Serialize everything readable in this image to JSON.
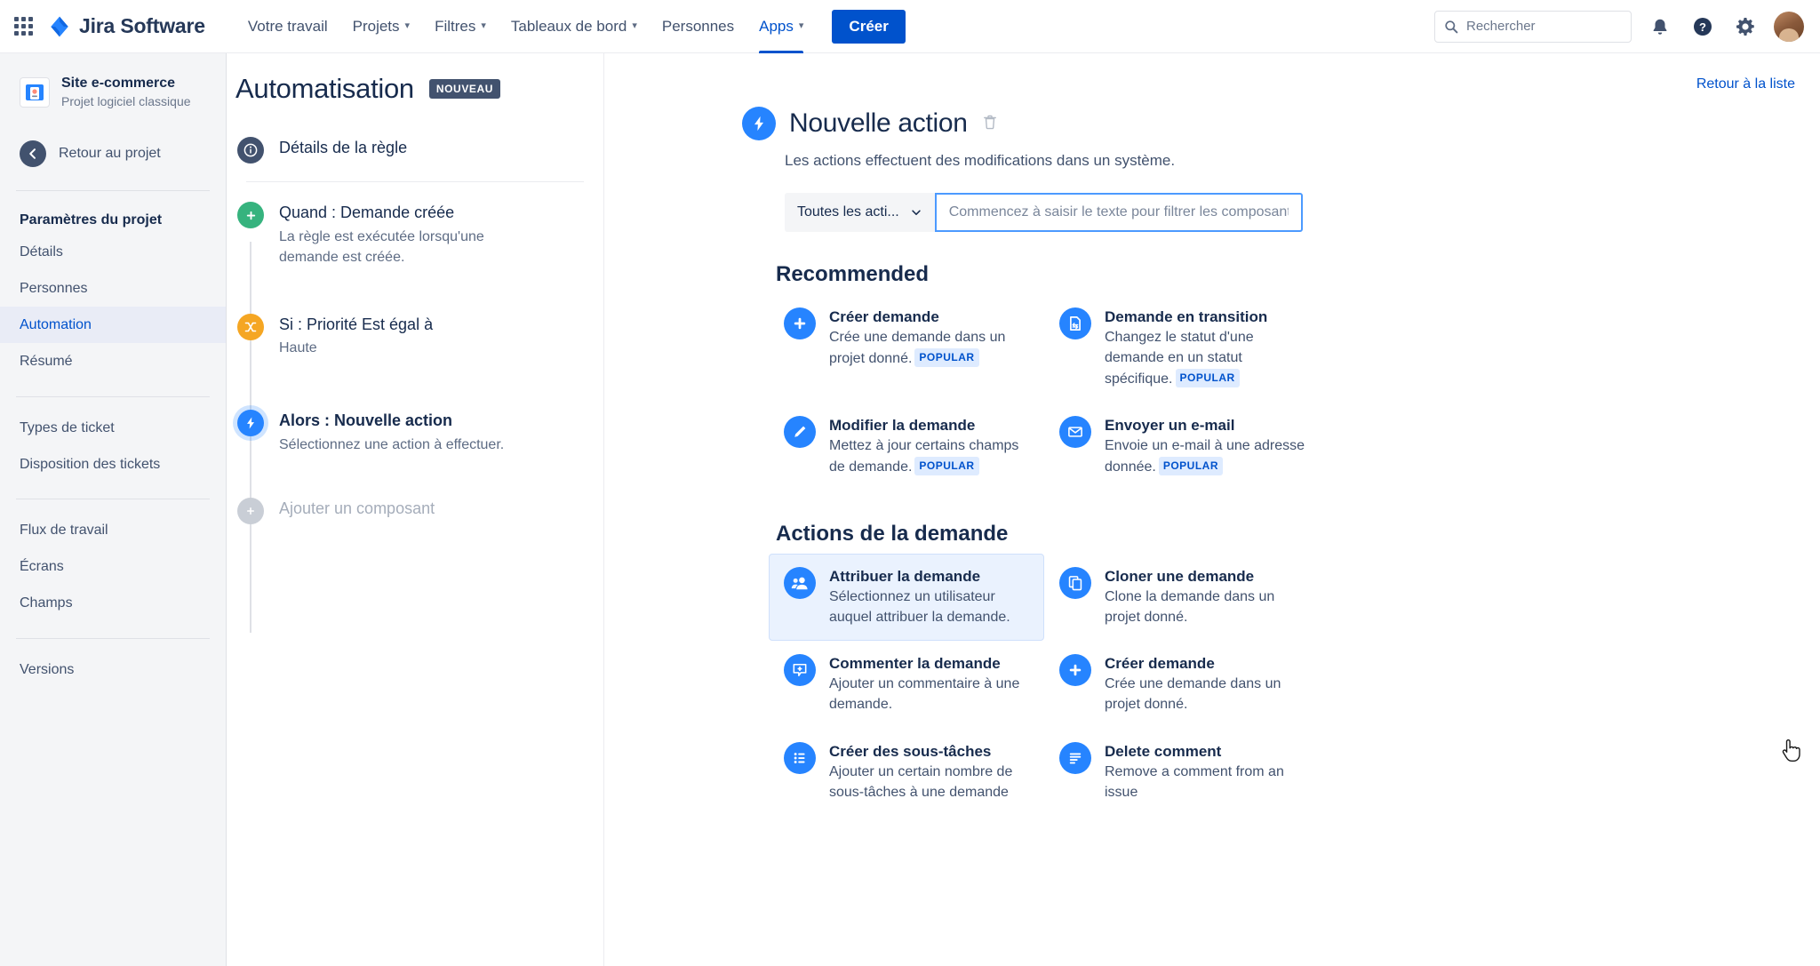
{
  "topnav": {
    "apps_grid_icon": "apps-grid-icon",
    "brand": "Jira Software",
    "items": [
      {
        "label": "Votre travail",
        "has_caret": false,
        "active": false
      },
      {
        "label": "Projets",
        "has_caret": true,
        "active": false
      },
      {
        "label": "Filtres",
        "has_caret": true,
        "active": false
      },
      {
        "label": "Tableaux de bord",
        "has_caret": true,
        "active": false
      },
      {
        "label": "Personnes",
        "has_caret": false,
        "active": false
      },
      {
        "label": "Apps",
        "has_caret": true,
        "active": true
      }
    ],
    "create_label": "Créer",
    "search_placeholder": "Rechercher",
    "icons": [
      "search-icon",
      "notifications-icon",
      "help-icon",
      "settings-icon",
      "avatar"
    ]
  },
  "sidebar": {
    "project_name": "Site e-commerce",
    "project_type": "Projet logiciel classique",
    "back_label": "Retour au projet",
    "settings_heading": "Paramètres du projet",
    "group1": [
      "Détails",
      "Personnes",
      "Automation",
      "Résumé"
    ],
    "group2": [
      "Types de ticket",
      "Disposition des tickets"
    ],
    "group3": [
      "Flux de travail",
      "Écrans",
      "Champs"
    ],
    "group4": [
      "Versions"
    ],
    "active_item": "Automation"
  },
  "rule_panel": {
    "page_title": "Automatisation",
    "new_badge": "NOUVEAU",
    "details_label": "Détails de la règle",
    "steps": [
      {
        "kind": "trigger",
        "title": "Quand : Demande créée",
        "desc": "La règle est exécutée lorsqu'une demande est créée."
      },
      {
        "kind": "condition",
        "title": "Si : Priorité Est égal à",
        "desc": "Haute"
      },
      {
        "kind": "action",
        "title": "Alors : Nouvelle action",
        "desc": "Sélectionnez une action à effectuer."
      }
    ],
    "add_component_label": "Ajouter un composant"
  },
  "main": {
    "back_to_list": "Retour à la liste",
    "title": "Nouvelle action",
    "subtitle": "Les actions effectuent des modifications dans un système.",
    "filter_select_value": "Toutes les acti...",
    "filter_input_placeholder": "Commencez à saisir le texte pour filtrer les composants",
    "filter_input_value": "",
    "popular_badge": "POPULAR",
    "sections": [
      {
        "title": "Recommended",
        "cards": [
          {
            "icon": "create-issue-icon",
            "name": "Créer demande",
            "desc": "Crée une demande dans un projet donné.",
            "popular": true,
            "selected": false
          },
          {
            "icon": "transition-issue-icon",
            "name": "Demande en transition",
            "desc": "Changez le statut d'une demande en un statut spécifique.",
            "popular": true,
            "selected": false
          },
          {
            "icon": "edit-issue-icon",
            "name": "Modifier la demande",
            "desc": "Mettez à jour certains champs de demande.",
            "popular": true,
            "selected": false
          },
          {
            "icon": "send-email-icon",
            "name": "Envoyer un e-mail",
            "desc": "Envoie un e-mail à une adresse donnée.",
            "popular": true,
            "selected": false
          }
        ]
      },
      {
        "title": "Actions de la demande",
        "cards": [
          {
            "icon": "assign-issue-icon",
            "name": "Attribuer la demande",
            "desc": "Sélectionnez un utilisateur auquel attribuer la demande.",
            "popular": false,
            "selected": true
          },
          {
            "icon": "clone-issue-icon",
            "name": "Cloner une demande",
            "desc": "Clone la demande dans un projet donné.",
            "popular": false,
            "selected": false
          },
          {
            "icon": "comment-issue-icon",
            "name": "Commenter la demande",
            "desc": "Ajouter un commentaire à une demande.",
            "popular": false,
            "selected": false
          },
          {
            "icon": "create-issue-icon",
            "name": "Créer demande",
            "desc": "Crée une demande dans un projet donné.",
            "popular": false,
            "selected": false
          },
          {
            "icon": "create-subtasks-icon",
            "name": "Créer des sous-tâches",
            "desc": "Ajouter un certain nombre de sous-tâches à une demande",
            "popular": false,
            "selected": false
          },
          {
            "icon": "delete-comment-icon",
            "name": "Delete comment",
            "desc": "Remove a comment from an issue",
            "popular": false,
            "selected": false
          }
        ]
      }
    ]
  },
  "colors": {
    "brand_blue": "#0052cc",
    "accent_blue": "#2684ff",
    "trigger_green": "#36b37e",
    "condition_orange": "#f5a623",
    "badge_navy": "#42526e",
    "selected_card_bg": "#eaf2fe"
  }
}
